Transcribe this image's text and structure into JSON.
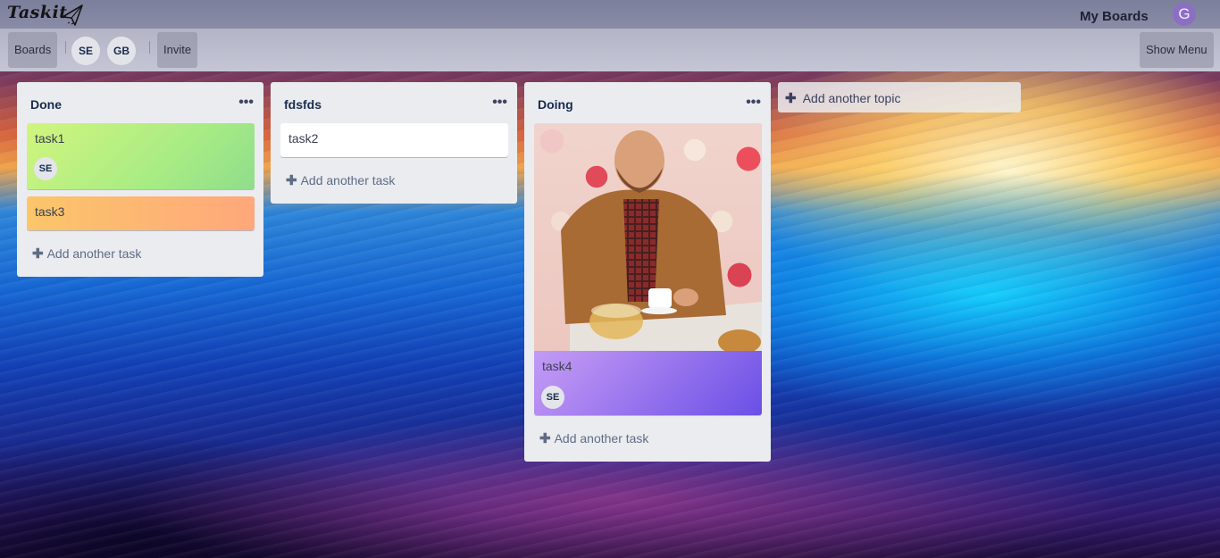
{
  "app": {
    "logo_text": "Taskit",
    "my_boards_label": "My Boards",
    "user_avatar_initial": "G"
  },
  "board_bar": {
    "boards_label": "Boards",
    "members": [
      "SE",
      "GB"
    ],
    "invite_label": "Invite",
    "show_menu_label": "Show Menu"
  },
  "lists": [
    {
      "title": "Done",
      "menu_icon": "more-horizontal-icon",
      "cards": [
        {
          "title": "task1",
          "member": "SE",
          "color": "#c6f17a"
        },
        {
          "title": "task3",
          "color": "#ffb06b"
        }
      ],
      "add_task_label": "Add another task"
    },
    {
      "title": "fdsfds",
      "menu_icon": "more-horizontal-icon",
      "cards": [
        {
          "title": "task2",
          "color": "#ffffff"
        }
      ],
      "add_task_label": "Add another task"
    },
    {
      "title": "Doing",
      "menu_icon": "more-horizontal-icon",
      "cards": [
        {
          "title": "task4",
          "member": "SE",
          "cover": "photo-cover",
          "color": "#c8a6f5"
        }
      ],
      "add_task_label": "Add another task"
    }
  ],
  "add_topic_label": "Add another topic",
  "colors": {
    "topbar": "#7b7f9c",
    "list_bg": "#ebecf0",
    "task1_gradient": [
      "#d1f57e",
      "#91e08c"
    ],
    "task3_gradient": [
      "#fbc569",
      "#ff9f7b"
    ],
    "task4_gradient": [
      "#e7c9fb",
      "#6b4ee6"
    ]
  }
}
